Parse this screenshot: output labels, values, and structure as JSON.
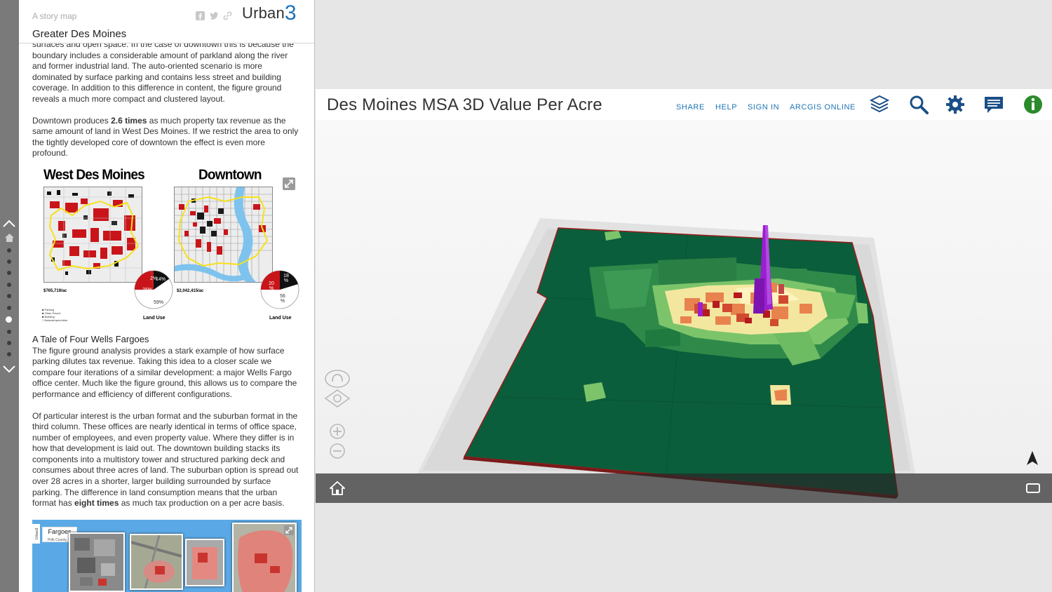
{
  "story": {
    "kicker": "A story map",
    "title": "Greater Des Moines",
    "logo_text": "Urban",
    "logo_num": "3",
    "paragraphs": {
      "p1": "surfaces and open space. In the case of downtown this is because the boundary includes a considerable amount of parkland along the river and former industrial land. The auto-oriented scenario is more dominated by surface parking and contains less street and building coverage. In addition to this difference in content, the figure ground reveals a much more compact and clustered layout.",
      "p2_pre": "Downtown produces ",
      "p2_bold": "2.6 times",
      "p2_post": " as much property tax revenue as the same amount of land in West Des Moines. If we restrict the area to only the tightly developed core of downtown the effect is even more profound.",
      "h_wells": "A Tale of Four Wells Fargoes",
      "p3": "The figure ground analysis provides a stark example of how surface parking dilutes tax revenue. Taking this idea to a closer scale we compare four iterations of a similar development: a major Wells Fargo office center. Much like the figure ground, this allows us to compare the performance and efficiency of different configurations.",
      "p4_pre": "Of particular interest is the urban format and the suburban format in the third column. These offices are nearly identical in terms of office space, number of employees, and even property value. Where they differ is in how that development is laid out. The downtown building stacks its components into a multistory tower and structured parking deck and consumes about three acres of land. The suburban option is spread out over 28 acres in a shorter, larger building surrounded by surface parking. The difference in land consumption means that the urban format has ",
      "p4_bold": "eight times",
      "p4_post": " as much tax production on a per acre basis."
    },
    "figure1": {
      "left_title": "West Des Moines",
      "right_title": "Downtown",
      "left_value": "$765,719/ac",
      "right_value": "$2,042,415/ac",
      "left_pie": {
        "a": "2%",
        "b": "14%",
        "c": "25%",
        "d": "59%"
      },
      "right_pie": {
        "a": "18 %",
        "b": "20 %",
        "c": "56 %"
      },
      "landuse_label": "Land Use",
      "legend": [
        "Parking",
        "Other Paved",
        "Building",
        "Natural/open/other"
      ]
    },
    "figure2": {
      "label": "Fargoes",
      "sublabel": "Polk County, IA",
      "logo_text": "Urban3"
    }
  },
  "map": {
    "title": "Des Moines MSA 3D Value Per Acre",
    "links": [
      "SHARE",
      "HELP",
      "SIGN IN",
      "ARCGIS ONLINE"
    ],
    "colors": {
      "link": "#1f74b3",
      "base_green": "#0b5e3b",
      "mid_green": "#2f8a4a",
      "light_green": "#7cc46a",
      "yellow": "#f3e7a0",
      "orange": "#e8834e",
      "red": "#c4221f",
      "purple": "#9a1fd0"
    }
  }
}
